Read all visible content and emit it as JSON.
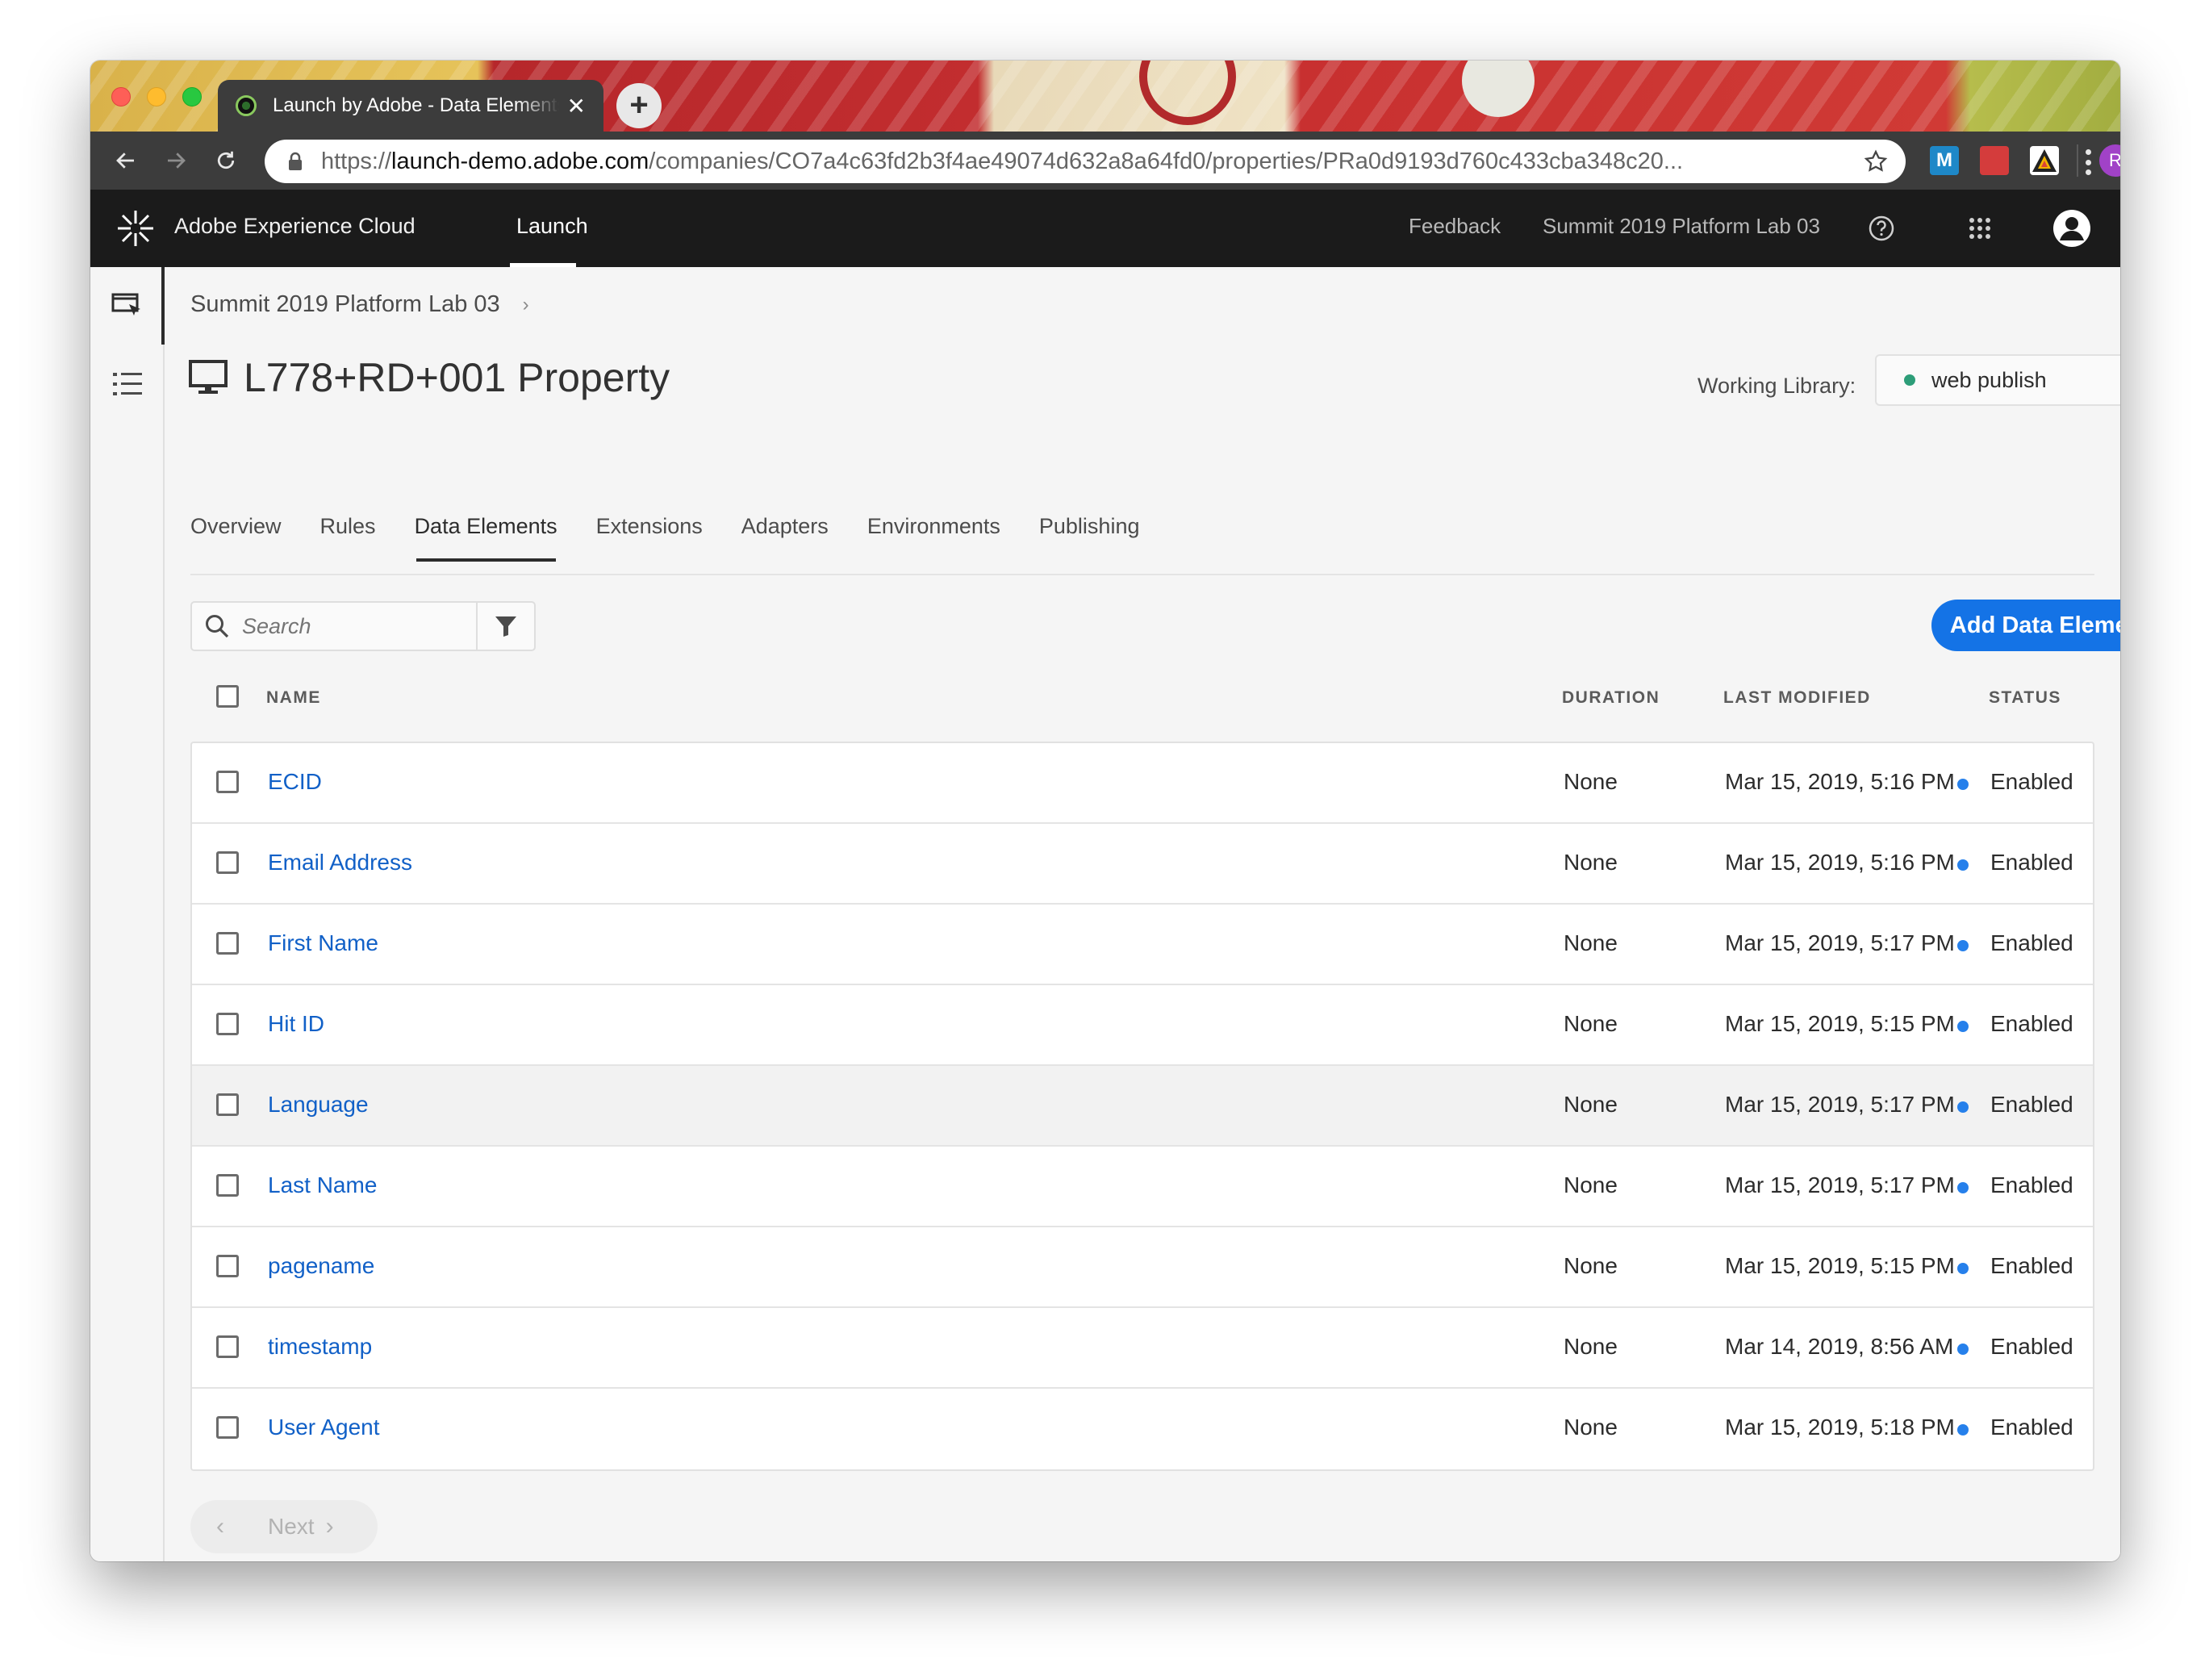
{
  "browser": {
    "tab_title": "Launch by Adobe - Data Elements",
    "url_scheme": "https://",
    "url_host": "launch-demo.adobe.com",
    "url_path": "/companies/CO7a4c63fd2b3f4ae49074d632a8a64fd0/properties/PRa0d9193d760c433cba348c20...",
    "profile_initial": "R",
    "extension_m_label": "M"
  },
  "header": {
    "brand": "Adobe Experience Cloud",
    "app_tab": "Launch",
    "feedback": "Feedback",
    "org": "Summit 2019 Platform Lab 03"
  },
  "page": {
    "breadcrumb": "Summit 2019 Platform Lab 03",
    "title": "L778+RD+001 Property",
    "working_library_label": "Working Library:",
    "working_library_value": "web publish"
  },
  "tabs": [
    "Overview",
    "Rules",
    "Data Elements",
    "Extensions",
    "Adapters",
    "Environments",
    "Publishing"
  ],
  "active_tab": "Data Elements",
  "search": {
    "placeholder": "Search"
  },
  "add_button": "Add Data Element",
  "table": {
    "columns": {
      "name": "NAME",
      "duration": "DURATION",
      "last_modified": "LAST MODIFIED",
      "status": "STATUS"
    },
    "rows": [
      {
        "name": "ECID",
        "duration": "None",
        "modified": "Mar 15, 2019, 5:16 PM",
        "status": "Enabled"
      },
      {
        "name": "Email Address",
        "duration": "None",
        "modified": "Mar 15, 2019, 5:16 PM",
        "status": "Enabled"
      },
      {
        "name": "First Name",
        "duration": "None",
        "modified": "Mar 15, 2019, 5:17 PM",
        "status": "Enabled"
      },
      {
        "name": "Hit ID",
        "duration": "None",
        "modified": "Mar 15, 2019, 5:15 PM",
        "status": "Enabled"
      },
      {
        "name": "Language",
        "duration": "None",
        "modified": "Mar 15, 2019, 5:17 PM",
        "status": "Enabled"
      },
      {
        "name": "Last Name",
        "duration": "None",
        "modified": "Mar 15, 2019, 5:17 PM",
        "status": "Enabled"
      },
      {
        "name": "pagename",
        "duration": "None",
        "modified": "Mar 15, 2019, 5:15 PM",
        "status": "Enabled"
      },
      {
        "name": "timestamp",
        "duration": "None",
        "modified": "Mar 14, 2019, 8:56 AM",
        "status": "Enabled"
      },
      {
        "name": "User Agent",
        "duration": "None",
        "modified": "Mar 15, 2019, 5:18 PM",
        "status": "Enabled"
      }
    ]
  },
  "pager": {
    "next": "Next"
  },
  "colors": {
    "accent": "#1473e6",
    "link": "#1160c7",
    "status_enabled": "#2680eb",
    "library_dot": "#2d9d78"
  }
}
